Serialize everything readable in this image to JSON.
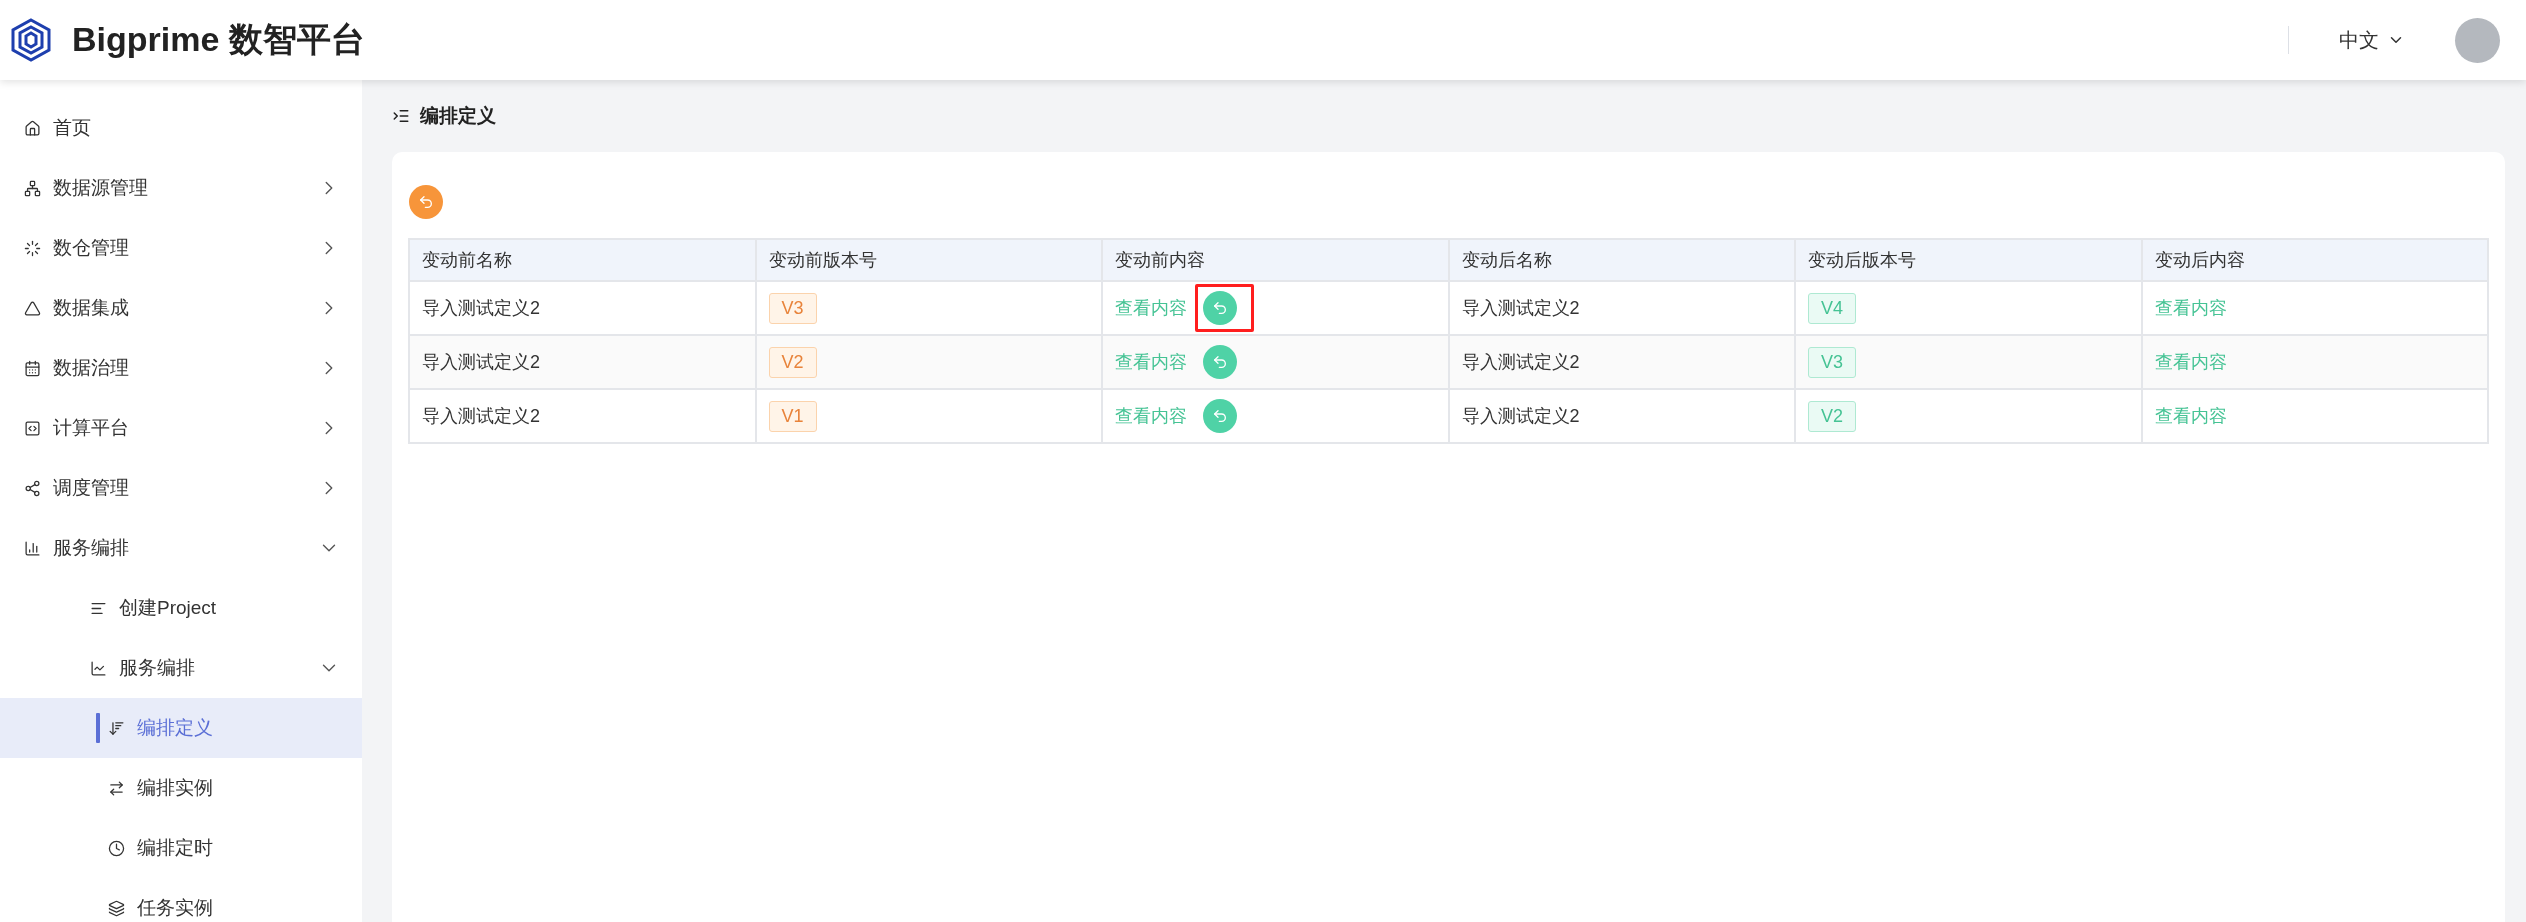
{
  "header": {
    "title": "Bigprime 数智平台",
    "language": "中文"
  },
  "sidebar": {
    "items": [
      {
        "label": "首页",
        "selected": false
      },
      {
        "label": "数据源管理",
        "expanded": false,
        "selected": false
      },
      {
        "label": "数仓管理",
        "expanded": false,
        "selected": false
      },
      {
        "label": "数据集成",
        "expanded": false,
        "selected": false
      },
      {
        "label": "数据治理",
        "expanded": false,
        "selected": false
      },
      {
        "label": "计算平台",
        "expanded": false,
        "selected": false
      },
      {
        "label": "调度管理",
        "expanded": false,
        "selected": false
      },
      {
        "label": "服务编排",
        "expanded": true,
        "selected": false,
        "children": [
          {
            "label": "创建Project",
            "selected": false
          },
          {
            "label": "服务编排",
            "expanded": true,
            "selected": false,
            "children": [
              {
                "label": "编排定义",
                "selected": true
              },
              {
                "label": "编排实例",
                "selected": false
              },
              {
                "label": "编排定时",
                "selected": false
              },
              {
                "label": "任务实例",
                "selected": false
              }
            ]
          }
        ]
      }
    ]
  },
  "breadcrumb": "编排定义",
  "table": {
    "columns": [
      "变动前名称",
      "变动前版本号",
      "变动前内容",
      "变动后名称",
      "变动后版本号",
      "变动后内容"
    ],
    "rows": [
      {
        "before_name": "导入测试定义2",
        "before_version": "V3",
        "before_content": "查看内容",
        "rollback_highlighted": true,
        "after_name": "导入测试定义2",
        "after_version": "V4",
        "after_content": "查看内容"
      },
      {
        "before_name": "导入测试定义2",
        "before_version": "V2",
        "before_content": "查看内容",
        "rollback_highlighted": false,
        "after_name": "导入测试定义2",
        "after_version": "V3",
        "after_content": "查看内容"
      },
      {
        "before_name": "导入测试定义2",
        "before_version": "V1",
        "before_content": "查看内容",
        "rollback_highlighted": false,
        "after_name": "导入测试定义2",
        "after_version": "V2",
        "after_content": "查看内容"
      }
    ]
  }
}
